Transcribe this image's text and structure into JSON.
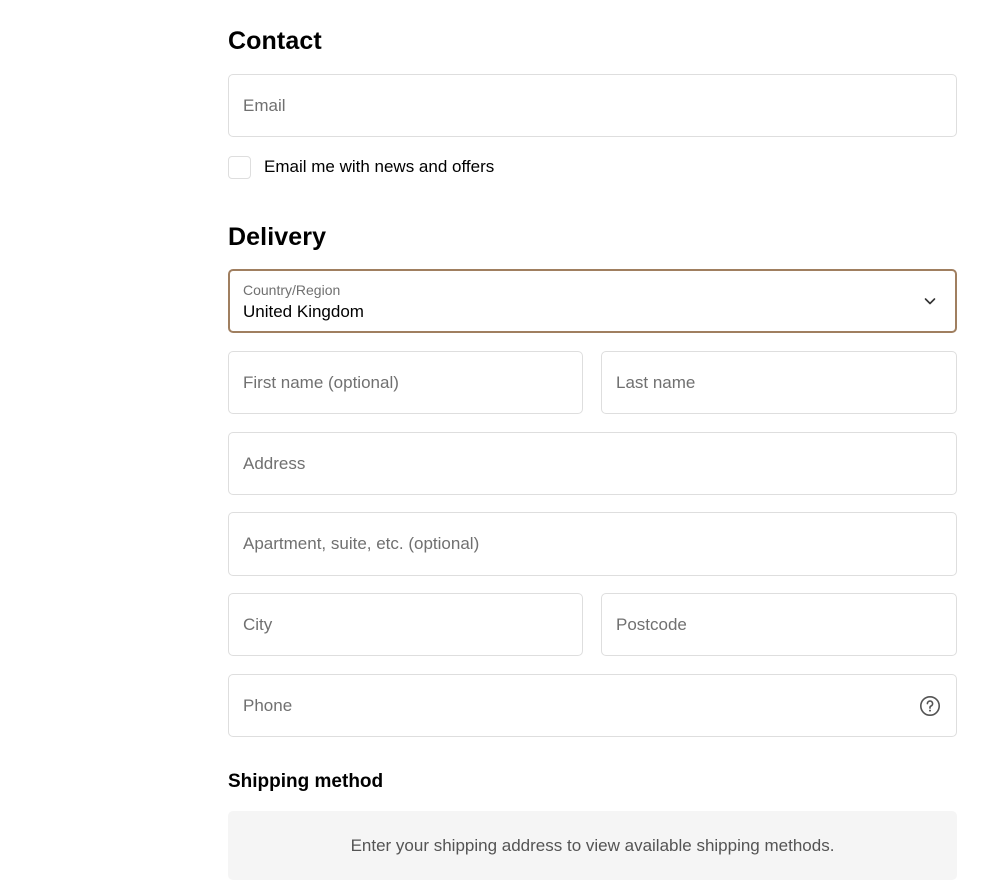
{
  "contact": {
    "title": "Contact",
    "email_placeholder": "Email",
    "email_value": "",
    "newsletter_label": "Email me with news and offers",
    "newsletter_checked": false
  },
  "delivery": {
    "title": "Delivery",
    "country_label": "Country/Region",
    "country_value": "United Kingdom",
    "first_name_placeholder": "First name (optional)",
    "last_name_placeholder": "Last name",
    "address_placeholder": "Address",
    "apartment_placeholder": "Apartment, suite, etc. (optional)",
    "city_placeholder": "City",
    "postcode_placeholder": "Postcode",
    "phone_placeholder": "Phone"
  },
  "shipping": {
    "title": "Shipping method",
    "message": "Enter your shipping address to view available shipping methods."
  },
  "icons": {
    "select_chevron": "chevron-down-icon",
    "phone_help": "help-circle-icon"
  },
  "colors": {
    "focus_border": "#a07f60",
    "field_border": "#dedede",
    "placeholder": "#707070",
    "shipping_bg": "#f5f5f5"
  }
}
